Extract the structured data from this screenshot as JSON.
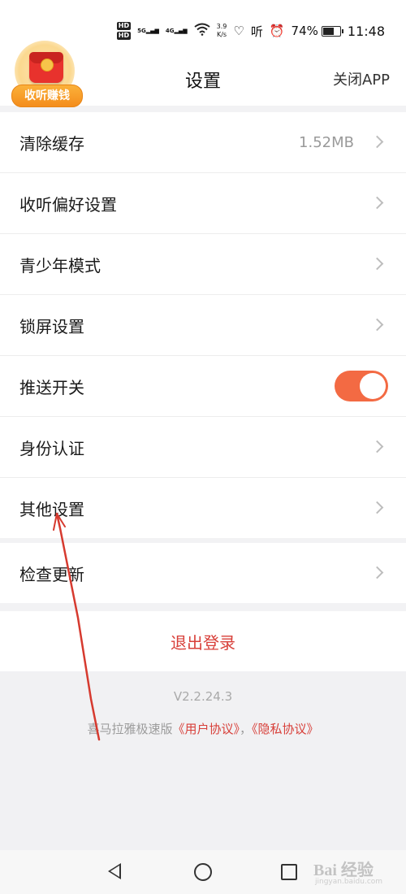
{
  "status_bar": {
    "hd1": "HD",
    "hd2": "HD",
    "signal1": "5G",
    "signal2": "4G",
    "net_speed_value": "3.9",
    "net_speed_unit": "K/s",
    "listen_icon_text": "听",
    "battery_percent": "74%",
    "battery_level": 0.74,
    "time": "11:48"
  },
  "header": {
    "title": "设置",
    "close_app": "关闭APP",
    "promo_label": "收听赚钱"
  },
  "settings_group1": [
    {
      "label": "清除缓存",
      "value": "1.52MB",
      "type": "chevron"
    },
    {
      "label": "收听偏好设置",
      "type": "chevron"
    },
    {
      "label": "青少年模式",
      "type": "chevron"
    },
    {
      "label": "锁屏设置",
      "type": "chevron"
    },
    {
      "label": "推送开关",
      "type": "toggle",
      "on": true
    },
    {
      "label": "身份认证",
      "type": "chevron"
    },
    {
      "label": "其他设置",
      "type": "chevron"
    }
  ],
  "settings_group2": [
    {
      "label": "检查更新",
      "type": "chevron"
    }
  ],
  "logout": "退出登录",
  "footer": {
    "version": "V2.2.24.3",
    "prefix": "喜马拉雅极速版",
    "user_agreement": "《用户协议》",
    "separator": "，",
    "privacy_agreement": "《隐私协议》"
  },
  "watermark": {
    "text": "Bai 经验",
    "sub": "jingyan.baidu.com"
  },
  "colors": {
    "accent": "#f36a43",
    "danger": "#d8403a",
    "annotation": "#d63a2f"
  }
}
